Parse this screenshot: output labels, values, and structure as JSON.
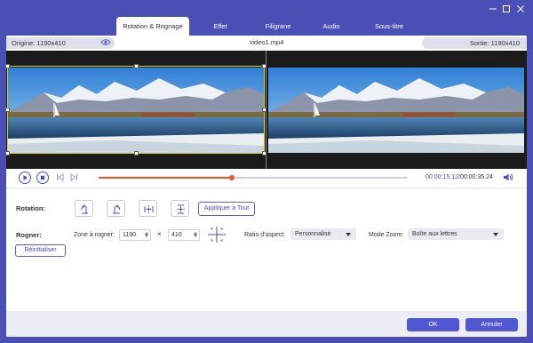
{
  "window": {
    "minimize_icon": "minimize-icon",
    "maximize_icon": "maximize-icon",
    "close_icon": "close-icon"
  },
  "tabs": [
    {
      "label": "Rotation & Rognage",
      "active": true
    },
    {
      "label": "Effet",
      "active": false
    },
    {
      "label": "Filigrane",
      "active": false
    },
    {
      "label": "Audio",
      "active": false
    },
    {
      "label": "Sous-titre",
      "active": false
    }
  ],
  "infobar": {
    "origin": "Origine: 1190x410",
    "filename": "video1.mp4",
    "output": "Sortie: 1190x410",
    "eye_icon": "eye-icon"
  },
  "playback": {
    "current_time": "00:00:15.12",
    "separator": "/",
    "total_time": "00:00:35.24",
    "progress": 0.43,
    "play_icon": "play-icon",
    "stop_icon": "stop-icon",
    "prev_icon": "previous-frame-icon",
    "next_icon": "next-frame-icon",
    "volume_icon": "volume-icon"
  },
  "rotation": {
    "label": "Rotation:",
    "buttons": [
      "rotate-left-icon",
      "rotate-right-icon",
      "flip-horizontal-icon",
      "flip-vertical-icon"
    ],
    "apply_all": "Appliquer à Tout"
  },
  "crop": {
    "label": "Rogner:",
    "zone_label": "Zone à rogner:",
    "width": "1190",
    "times": "×",
    "height": "410",
    "center_icon": "crosshair-center-icon",
    "aspect_label": "Ratio d'aspect:",
    "aspect_value": "Personnalisé",
    "zoom_label": "Mode Zoom:",
    "zoom_value": "Boîte aux lettres",
    "reset": "Réinitialiser"
  },
  "footer": {
    "ok": "OK",
    "cancel": "Annuler"
  },
  "colors": {
    "accent": "#4a4fb6",
    "progress": "#f0542a",
    "crop_frame": "#d8d02a"
  }
}
